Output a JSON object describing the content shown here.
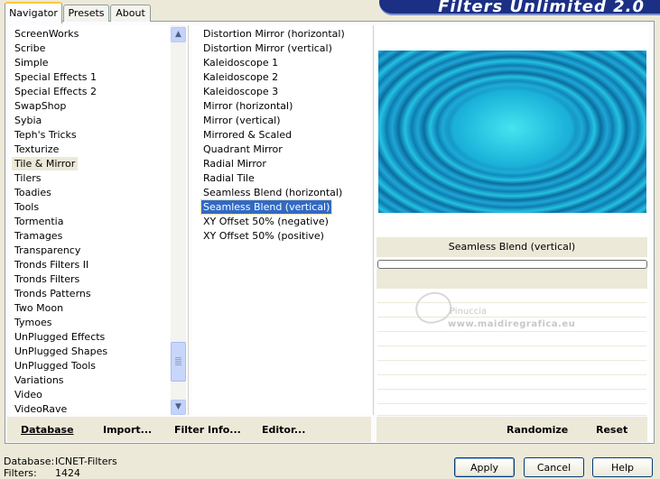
{
  "tabs": [
    {
      "label": "Navigator"
    },
    {
      "label": "Presets"
    },
    {
      "label": "About"
    }
  ],
  "banner": {
    "title": "Filters Unlimited 2.0"
  },
  "categories": [
    "ScreenWorks",
    "Scribe",
    "Simple",
    "Special Effects 1",
    "Special Effects 2",
    "SwapShop",
    "Sybia",
    "Teph's Tricks",
    "Texturize",
    "Tile & Mirror",
    "Tilers",
    "Toadies",
    "Tools",
    "Tormentia",
    "Tramages",
    "Transparency",
    "Tronds Filters II",
    "Tronds Filters",
    "Tronds Patterns",
    "Two Moon",
    "Tymoes",
    "UnPlugged Effects",
    "UnPlugged Shapes",
    "UnPlugged Tools",
    "Variations",
    "Video",
    "VideoRave"
  ],
  "selected_category": "Tile & Mirror",
  "filters": [
    "Distortion Mirror (horizontal)",
    "Distortion Mirror (vertical)",
    "Kaleidoscope 1",
    "Kaleidoscope 2",
    "Kaleidoscope 3",
    "Mirror (horizontal)",
    "Mirror (vertical)",
    "Mirrored & Scaled",
    "Quadrant Mirror",
    "Radial Mirror",
    "Radial Tile",
    "Seamless Blend (horizontal)",
    "Seamless Blend (vertical)",
    "XY Offset 50% (negative)",
    "XY Offset 50% (positive)"
  ],
  "selected_filter": "Seamless Blend (vertical)",
  "preview": {
    "filter_name": "Seamless Blend (vertical)"
  },
  "watermark": {
    "line1": "Pinuccia",
    "line2": "www.maidiregrafica.eu"
  },
  "toolbar": {
    "database": "Database",
    "import": "Import...",
    "filter_info": "Filter Info...",
    "editor": "Editor...",
    "randomize": "Randomize",
    "reset": "Reset"
  },
  "status": {
    "database_label": "Database:",
    "database_value": "ICNET-Filters",
    "filters_label": "Filters:",
    "filters_value": "1424"
  },
  "buttons": {
    "apply": "Apply",
    "cancel": "Cancel",
    "help": "Help"
  },
  "colors": {
    "selection": "#316ac5",
    "banner": "#1b2f84",
    "panel": "#ece9d8"
  }
}
